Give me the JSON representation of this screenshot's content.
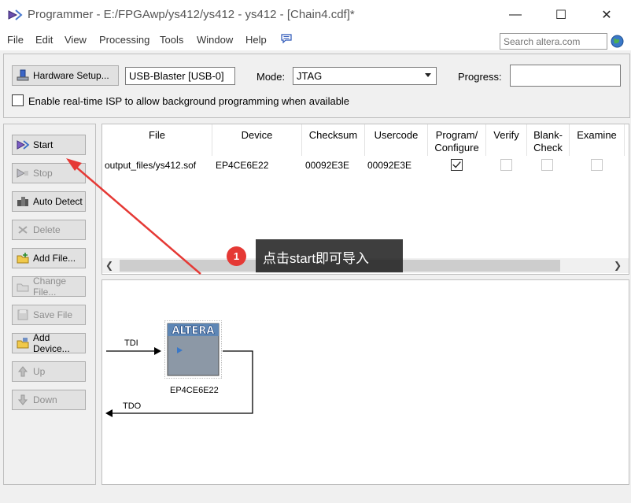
{
  "window": {
    "title": "Programmer - E:/FPGAwp/ys412/ys412 - ys412 - [Chain4.cdf]*",
    "minimize": "—",
    "maximize": "☐",
    "close": "✕"
  },
  "menu": {
    "items": [
      "File",
      "Edit",
      "View",
      "Processing",
      "Tools",
      "Window",
      "Help"
    ],
    "search_placeholder": "Search altera.com"
  },
  "hardware": {
    "setup_label": "Hardware Setup...",
    "device": "USB-Blaster [USB-0]",
    "mode_label": "Mode:",
    "mode_value": "JTAG",
    "progress_label": "Progress:",
    "isp_label": "Enable real-time ISP to allow background programming when available",
    "isp_checked": false
  },
  "sidebar": {
    "buttons": [
      {
        "label": "Start",
        "enabled": true,
        "icon": "start-icon"
      },
      {
        "label": "Stop",
        "enabled": false,
        "icon": "stop-icon"
      },
      {
        "label": "Auto Detect",
        "enabled": true,
        "icon": "auto-detect-icon"
      },
      {
        "label": "Delete",
        "enabled": false,
        "icon": "delete-icon"
      },
      {
        "label": "Add File...",
        "enabled": true,
        "icon": "add-file-icon"
      },
      {
        "label": "Change File...",
        "enabled": false,
        "icon": "change-file-icon"
      },
      {
        "label": "Save File",
        "enabled": false,
        "icon": "save-file-icon"
      },
      {
        "label": "Add Device...",
        "enabled": true,
        "icon": "add-device-icon"
      },
      {
        "label": "Up",
        "enabled": false,
        "icon": "up-icon"
      },
      {
        "label": "Down",
        "enabled": false,
        "icon": "down-icon"
      }
    ]
  },
  "table": {
    "columns": [
      "File",
      "Device",
      "Checksum",
      "Usercode",
      "Program/\nConfigure",
      "Verify",
      "Blank-\nCheck",
      "Examine"
    ],
    "rows": [
      {
        "file": "output_files/ys412.sof",
        "device": "EP4CE6E22",
        "checksum": "00092E3E",
        "usercode": "00092E3E",
        "program": true,
        "verify": false,
        "blank_check": false,
        "examine": false
      }
    ]
  },
  "chain": {
    "chip_brand": "ALTERA",
    "chip_name": "EP4CE6E22",
    "tdi": "TDI",
    "tdo": "TDO"
  },
  "annotation": {
    "step": "1",
    "text": "点击start即可导入",
    "color": "#e53935"
  }
}
